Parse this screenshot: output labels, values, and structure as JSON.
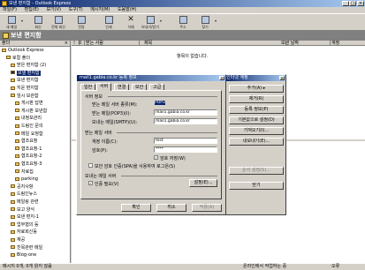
{
  "window": {
    "title": "보낸 편지함 - Outlook Express",
    "controls": [
      "_",
      "□",
      "×"
    ]
  },
  "menu": [
    "파일(F)",
    "편집(E)",
    "보기(V)",
    "도구(T)",
    "메시지(M)",
    "도움말(H)"
  ],
  "toolbar": [
    {
      "label": "새 메일",
      "icon": "new-mail-icon"
    },
    {
      "label": "회신",
      "icon": "reply-icon"
    },
    {
      "label": "전체 회신",
      "icon": "reply-all-icon"
    },
    {
      "label": "전달",
      "icon": "forward-icon"
    },
    {
      "label": "인쇄",
      "icon": "print-icon"
    },
    {
      "label": "삭제",
      "icon": "delete-icon"
    },
    {
      "label": "보내기/받기",
      "icon": "send-receive-icon"
    },
    {
      "label": "주소",
      "icon": "address-book-icon"
    },
    {
      "label": "찾기",
      "icon": "find-icon"
    }
  ],
  "header": {
    "title": "보낸 편지함"
  },
  "folder_pane": {
    "header": "폴더",
    "close": "×",
    "items": [
      {
        "label": "Outlook Express",
        "indent": 0
      },
      {
        "label": "로컬 폴더",
        "indent": 1
      },
      {
        "label": "받은 편지함 (2)",
        "indent": 2
      },
      {
        "label": "보낼 편지함",
        "indent": 2,
        "selected": true
      },
      {
        "label": "보낸 편지함",
        "indent": 2
      },
      {
        "label": "지운 편지함",
        "indent": 2
      },
      {
        "label": "임시 보관함",
        "indent": 2
      },
      {
        "label": "게시판 답변",
        "indent": 3
      },
      {
        "label": "게시판 보낸함",
        "indent": 3
      },
      {
        "label": "내정보관리",
        "indent": 3
      },
      {
        "label": "드림인 문의",
        "indent": 3
      },
      {
        "label": "메일 요청함",
        "indent": 3
      },
      {
        "label": "협조요청",
        "indent": 3
      },
      {
        "label": "협조요청-1",
        "indent": 3
      },
      {
        "label": "협조요청-2",
        "indent": 3
      },
      {
        "label": "협조요청-3",
        "indent": 3
      },
      {
        "label": "자료집",
        "indent": 3
      },
      {
        "label": "parking",
        "indent": 3
      },
      {
        "label": "공지사항",
        "indent": 2
      },
      {
        "label": "드림인뉴스",
        "indent": 2
      },
      {
        "label": "메일링 관련",
        "indent": 2
      },
      {
        "label": "보고 양식",
        "indent": 2
      },
      {
        "label": "보낸 편지-1",
        "indent": 2
      },
      {
        "label": "업무협의 등",
        "indent": 2
      },
      {
        "label": "자료회신등",
        "indent": 2
      },
      {
        "label": "재공",
        "indent": 2
      },
      {
        "label": "친목관련 메일",
        "indent": 2
      },
      {
        "label": "Blog-one",
        "indent": 2
      }
    ]
  },
  "columns": [
    "!",
    "0",
    "받는 사람",
    "제목",
    "보낸 날짜",
    "계정"
  ],
  "empty_message": "항목이 없습니다.",
  "status": {
    "left": "메시지 0개, 0개 읽지 않음",
    "right": "온라인에서 작업하는 중",
    "error": "오류"
  },
  "accounts_dialog": {
    "title": "인터넷 계정",
    "buttons": [
      "추가(A)",
      "제거(R)",
      "등록 정보(P)",
      "기본값으로 설정(D)",
      "가져오기(I)...",
      "내보내기(E)...",
      "순서 설정(S)...",
      "닫기"
    ]
  },
  "props_dialog": {
    "title": "mail1.gabia.co.kr 등록 정보",
    "tabs": [
      "일반",
      "서버",
      "연결",
      "보안",
      "고급"
    ],
    "active_tab": 1,
    "section_server_info": "서버 정보",
    "incoming_type_label": "받는 메일 서버 종류(M):",
    "incoming_type_value": "POP3",
    "incoming_label": "받는 메일(POP3)(I):",
    "incoming_value": "mail1.gabia.co.kr",
    "outgoing_label": "보내는 메일(SMTP)(U):",
    "outgoing_value": "mail1.gabia.co.kr",
    "section_incoming": "받는 메일 서버",
    "account_label": "계정 이름(C):",
    "account_value": "test",
    "password_label": "암호(P):",
    "password_value": "****",
    "remember_label": "암호 저장(W)",
    "spa_label": "보안 암호 인증(SPA)을 사용하여 로그온(S)",
    "section_outgoing": "보내는 메일 서버",
    "auth_label": "인증 필요(V)",
    "settings_button": "설정(E)...",
    "ok": "확인",
    "cancel": "취소",
    "apply": "적용(A)"
  }
}
